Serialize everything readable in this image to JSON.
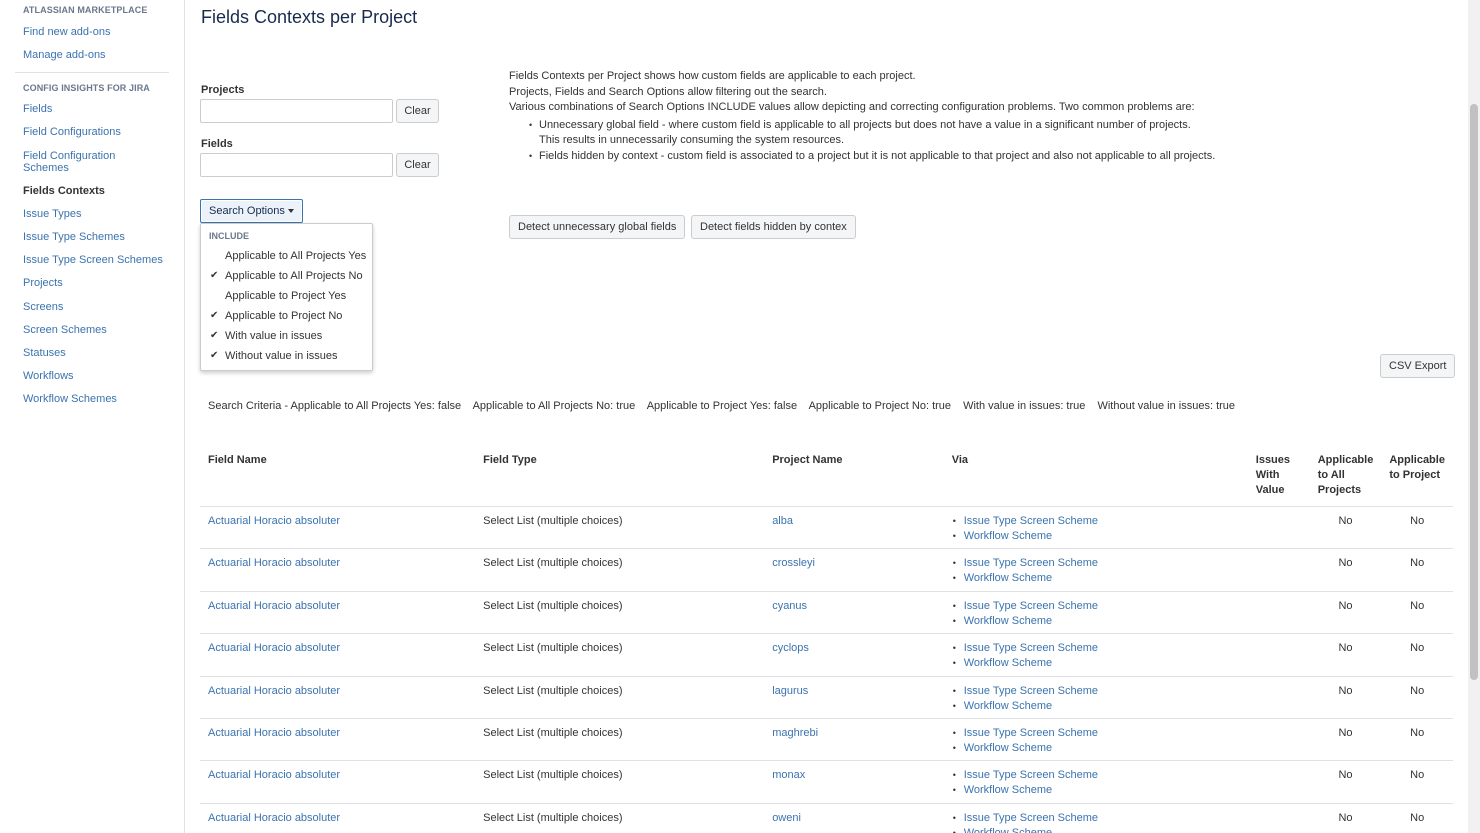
{
  "sidebar": {
    "marketplace_heading": "ATLASSIAN MARKETPLACE",
    "marketplace_items": [
      "Find new add-ons",
      "Manage add-ons"
    ],
    "config_heading": "CONFIG INSIGHTS FOR JIRA",
    "items": [
      {
        "label": "Fields",
        "active": false
      },
      {
        "label": "Field Configurations",
        "active": false
      },
      {
        "label": "Field Configuration Schemes",
        "active": false
      },
      {
        "label": "Fields Contexts",
        "active": true
      },
      {
        "label": "Issue Types",
        "active": false
      },
      {
        "label": "Issue Type Schemes",
        "active": false
      },
      {
        "label": "Issue Type Screen Schemes",
        "active": false
      },
      {
        "label": "Projects",
        "active": false
      },
      {
        "label": "Screens",
        "active": false
      },
      {
        "label": "Screen Schemes",
        "active": false
      },
      {
        "label": "Statuses",
        "active": false
      },
      {
        "label": "Workflows",
        "active": false
      },
      {
        "label": "Workflow Schemes",
        "active": false
      }
    ]
  },
  "page": {
    "title": "Fields Contexts per Project"
  },
  "filters": {
    "projects_label": "Projects",
    "projects_value": "",
    "fields_label": "Fields",
    "fields_value": "",
    "clear_label": "Clear"
  },
  "search_options": {
    "button_label": "Search Options",
    "heading": "INCLUDE",
    "items": [
      {
        "label": "Applicable to All Projects Yes",
        "checked": false
      },
      {
        "label": "Applicable to All Projects No",
        "checked": true
      },
      {
        "label": "Applicable to Project Yes",
        "checked": false
      },
      {
        "label": "Applicable to Project No",
        "checked": true
      },
      {
        "label": "With value in issues",
        "checked": true
      },
      {
        "label": "Without value in issues",
        "checked": true
      }
    ]
  },
  "description": {
    "lines": [
      "Fields Contexts per Project shows how custom fields are applicable to each project.",
      "Projects, Fields and Search Options allow filtering out the search.",
      "Various combinations of Search Options INCLUDE values allow depicting and correcting configuration problems. Two common problems are:"
    ],
    "bullets": [
      {
        "line1": "Unnecessary global field - where custom field is applicable to all projects but does not have a value in a significant number of projects.",
        "line2": "This results in unnecessarily consuming the system resources."
      },
      {
        "line1": "Fields hidden by context - custom field is associated to a project but it is not applicable to that project and also not applicable to all projects.",
        "line2": ""
      }
    ]
  },
  "actions": {
    "detect_global": "Detect unnecessary global fields",
    "detect_hidden": "Detect fields hidden by contex",
    "csv_export": "CSV Export"
  },
  "criteria": [
    "Search Criteria - Applicable to All Projects Yes: false",
    "Applicable to All Projects No: true",
    "Applicable to Project Yes: false",
    "Applicable to Project No: true",
    "With value in issues: true",
    "Without value in issues: true"
  ],
  "table": {
    "headers": {
      "field_name": "Field Name",
      "field_type": "Field Type",
      "project_name": "Project Name",
      "via": "Via",
      "issues_with_value": "Issues With Value",
      "applicable_all": "Applicable to All Projects",
      "applicable_project": "Applicable to Project"
    },
    "rows": [
      {
        "field": "Actuarial Horacio absoluter",
        "type": "Select List (multiple choices)",
        "project": "alba",
        "via": [
          "Issue Type Screen Scheme",
          "Workflow Scheme"
        ],
        "issues": "",
        "all": "No",
        "proj": "No"
      },
      {
        "field": "Actuarial Horacio absoluter",
        "type": "Select List (multiple choices)",
        "project": "crossleyi",
        "via": [
          "Issue Type Screen Scheme",
          "Workflow Scheme"
        ],
        "issues": "",
        "all": "No",
        "proj": "No"
      },
      {
        "field": "Actuarial Horacio absoluter",
        "type": "Select List (multiple choices)",
        "project": "cyanus",
        "via": [
          "Issue Type Screen Scheme",
          "Workflow Scheme"
        ],
        "issues": "",
        "all": "No",
        "proj": "No"
      },
      {
        "field": "Actuarial Horacio absoluter",
        "type": "Select List (multiple choices)",
        "project": "cyclops",
        "via": [
          "Issue Type Screen Scheme",
          "Workflow Scheme"
        ],
        "issues": "",
        "all": "No",
        "proj": "No"
      },
      {
        "field": "Actuarial Horacio absoluter",
        "type": "Select List (multiple choices)",
        "project": "lagurus",
        "via": [
          "Issue Type Screen Scheme",
          "Workflow Scheme"
        ],
        "issues": "",
        "all": "No",
        "proj": "No"
      },
      {
        "field": "Actuarial Horacio absoluter",
        "type": "Select List (multiple choices)",
        "project": "maghrebi",
        "via": [
          "Issue Type Screen Scheme",
          "Workflow Scheme"
        ],
        "issues": "",
        "all": "No",
        "proj": "No"
      },
      {
        "field": "Actuarial Horacio absoluter",
        "type": "Select List (multiple choices)",
        "project": "monax",
        "via": [
          "Issue Type Screen Scheme",
          "Workflow Scheme"
        ],
        "issues": "",
        "all": "No",
        "proj": "No"
      },
      {
        "field": "Actuarial Horacio absoluter",
        "type": "Select List (multiple choices)",
        "project": "oweni",
        "via": [
          "Issue Type Screen Scheme",
          "Workflow Scheme"
        ],
        "issues": "",
        "all": "No",
        "proj": "No"
      }
    ]
  }
}
